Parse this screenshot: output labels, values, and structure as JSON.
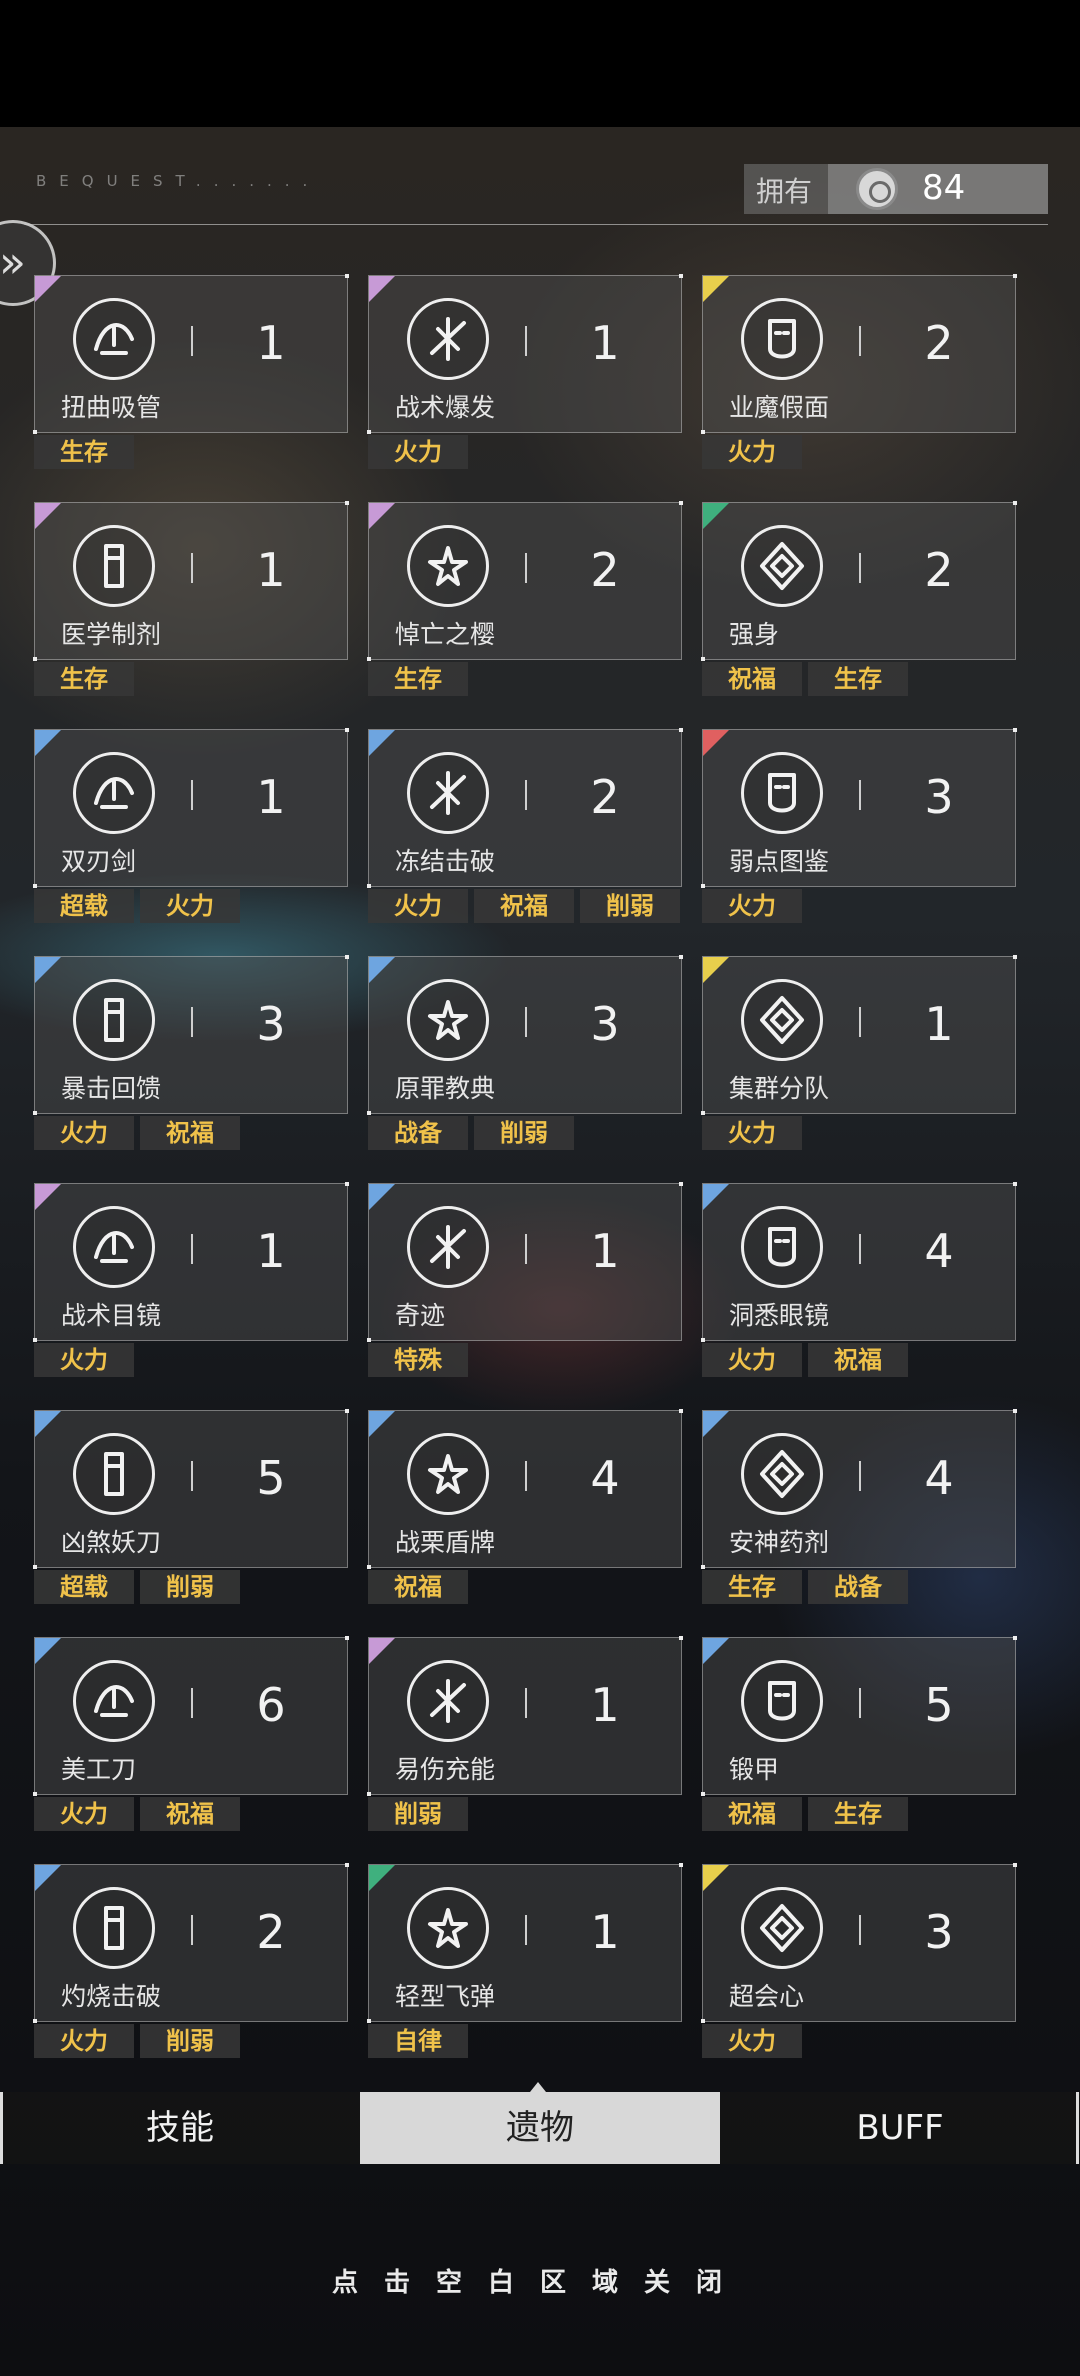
{
  "header": {
    "section_label": "BEQUEST.......",
    "owned_label": "拥有",
    "owned_value": "84",
    "owned_icon": "relic-coin-icon"
  },
  "side_button": {
    "icon": "double-chevron-right-icon",
    "glyph": "»"
  },
  "colors": {
    "tag_text": "#f0c24a",
    "rarity_purple": "#c79ad6",
    "rarity_yellow": "#e8cf4c",
    "rarity_green": "#3fb07e",
    "rarity_blue": "#6ea5e0",
    "rarity_red": "#e06060"
  },
  "relics": [
    {
      "name": "扭曲吸管",
      "count": "1",
      "rarity": "purple",
      "tags": [
        "生存"
      ],
      "icon": "twisted-straw-icon"
    },
    {
      "name": "战术爆发",
      "count": "1",
      "rarity": "purple",
      "tags": [
        "火力"
      ],
      "icon": "tactical-burst-icon"
    },
    {
      "name": "业魔假面",
      "count": "2",
      "rarity": "yellow",
      "tags": [
        "火力"
      ],
      "icon": "demon-mask-icon"
    },
    {
      "name": "医学制剂",
      "count": "1",
      "rarity": "purple",
      "tags": [
        "生存"
      ],
      "icon": "medicine-bottle-icon"
    },
    {
      "name": "悼亡之樱",
      "count": "2",
      "rarity": "purple",
      "tags": [
        "生存"
      ],
      "icon": "cherry-blossom-icon"
    },
    {
      "name": "强身",
      "count": "2",
      "rarity": "green",
      "tags": [
        "祝福",
        "生存"
      ],
      "icon": "strength-emblem-icon"
    },
    {
      "name": "双刃剑",
      "count": "1",
      "rarity": "blue",
      "tags": [
        "超载",
        "火力"
      ],
      "icon": "double-edged-sword-icon"
    },
    {
      "name": "冻结击破",
      "count": "2",
      "rarity": "blue",
      "tags": [
        "火力",
        "祝福",
        "削弱"
      ],
      "icon": "freeze-break-icon"
    },
    {
      "name": "弱点图鉴",
      "count": "3",
      "rarity": "red",
      "tags": [
        "火力"
      ],
      "icon": "weakness-book-icon"
    },
    {
      "name": "暴击回馈",
      "count": "3",
      "rarity": "blue",
      "tags": [
        "火力",
        "祝福"
      ],
      "icon": "crit-feedback-icon"
    },
    {
      "name": "原罪教典",
      "count": "3",
      "rarity": "blue",
      "tags": [
        "战备",
        "削弱"
      ],
      "icon": "sin-codex-icon"
    },
    {
      "name": "集群分队",
      "count": "1",
      "rarity": "yellow",
      "tags": [
        "火力"
      ],
      "icon": "swarm-squad-icon"
    },
    {
      "name": "战术目镜",
      "count": "1",
      "rarity": "purple",
      "tags": [
        "火力"
      ],
      "icon": "tactical-goggles-icon"
    },
    {
      "name": "奇迹",
      "count": "1",
      "rarity": "blue",
      "tags": [
        "特殊"
      ],
      "icon": "miracle-flower-icon"
    },
    {
      "name": "洞悉眼镜",
      "count": "4",
      "rarity": "blue",
      "tags": [
        "火力",
        "祝福"
      ],
      "icon": "insight-glasses-icon"
    },
    {
      "name": "凶煞妖刀",
      "count": "5",
      "rarity": "blue",
      "tags": [
        "超载",
        "削弱"
      ],
      "icon": "demon-blade-icon"
    },
    {
      "name": "战栗盾牌",
      "count": "4",
      "rarity": "blue",
      "tags": [
        "祝福"
      ],
      "icon": "trembling-shield-icon"
    },
    {
      "name": "安神药剂",
      "count": "4",
      "rarity": "blue",
      "tags": [
        "生存",
        "战备"
      ],
      "icon": "calming-potion-icon"
    },
    {
      "name": "美工刀",
      "count": "6",
      "rarity": "blue",
      "tags": [
        "火力",
        "祝福"
      ],
      "icon": "utility-knife-icon"
    },
    {
      "name": "易伤充能",
      "count": "1",
      "rarity": "purple",
      "tags": [
        "削弱"
      ],
      "icon": "vulnerable-charge-icon"
    },
    {
      "name": "锻甲",
      "count": "5",
      "rarity": "blue",
      "tags": [
        "祝福",
        "生存"
      ],
      "icon": "forged-armor-icon"
    },
    {
      "name": "灼烧击破",
      "count": "2",
      "rarity": "blue",
      "tags": [
        "火力",
        "削弱"
      ],
      "icon": "burn-break-icon"
    },
    {
      "name": "轻型飞弹",
      "count": "1",
      "rarity": "green",
      "tags": [
        "自律"
      ],
      "icon": "light-missile-icon"
    },
    {
      "name": "超会心",
      "count": "3",
      "rarity": "yellow",
      "tags": [
        "火力"
      ],
      "icon": "super-crit-icon"
    }
  ],
  "tabs": [
    {
      "label": "技能"
    },
    {
      "label": "遗物"
    },
    {
      "label": "BUFF"
    }
  ],
  "close_hint": "点击空白区域关闭"
}
